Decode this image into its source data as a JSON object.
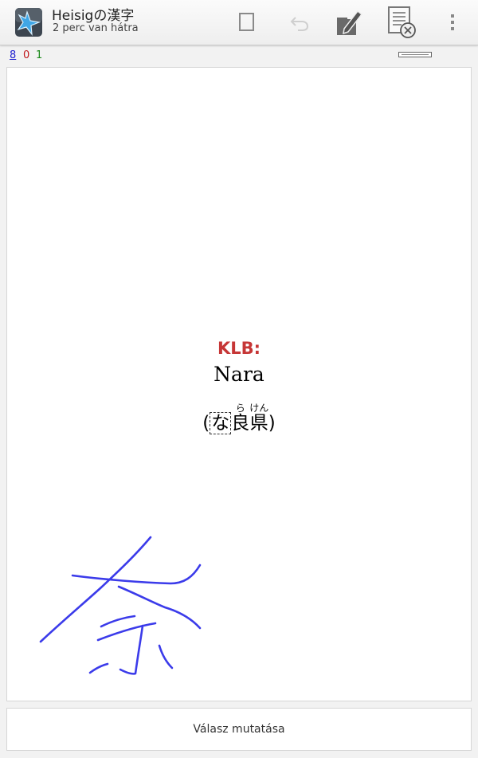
{
  "header": {
    "title": "Heisigの漢字",
    "subtitle": "2 perc van hátra"
  },
  "counts": {
    "new": "8",
    "learn": "0",
    "review": "1"
  },
  "card": {
    "label": "KLB:",
    "word": "Nara",
    "sentence": {
      "open": "(",
      "cloze": "な",
      "kanji1": "良",
      "reading1": "ら",
      "kanji2": "県",
      "reading2": "けん",
      "close": ")"
    }
  },
  "answer_button": "Válasz mutatása",
  "colors": {
    "label": "#c63636",
    "stroke": "#3b3bea",
    "new_count": "#1f1fcf",
    "learn_count": "#c0171b",
    "review_count": "#1a8a1a"
  },
  "icons": [
    "app-icon",
    "mark-card-icon",
    "undo-icon",
    "edit-note-icon",
    "bury-card-icon",
    "overflow-menu-icon"
  ]
}
